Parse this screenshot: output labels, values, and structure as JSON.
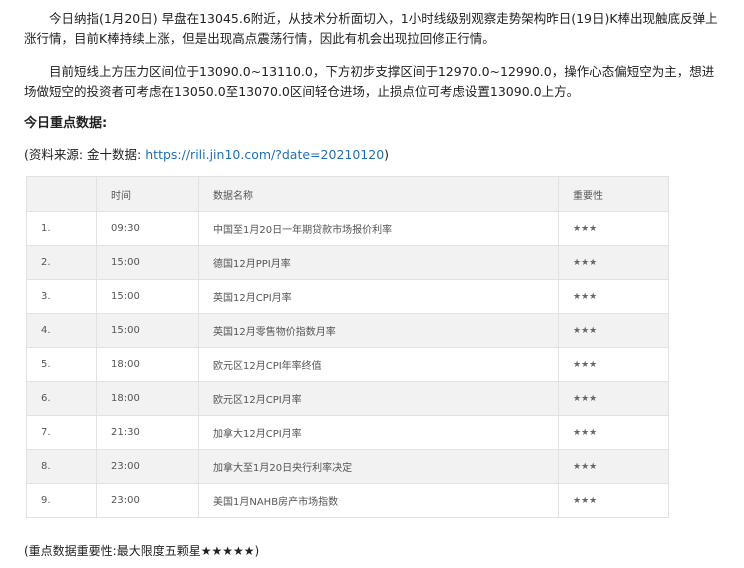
{
  "paragraphs": [
    "今日纳指(1月20日) 早盘在13045.6附近，从技术分析面切入，1小时线级别观察走势架构昨日(19日)K棒出现触底反弹上涨行情，目前K棒持续上涨，但是出现高点震荡行情，因此有机会出现拉回修正行情。",
    "目前短线上方压力区间位于13090.0~13110.0，下方初步支撑区间于12970.0~12990.0，操作心态偏短空为主，想进场做短空的投资者可考虑在13050.0至13070.0区间轻仓进场，止损点位可考虑设置13090.0上方。"
  ],
  "heading": "今日重点数据:",
  "source": {
    "prefix": "(资料来源: 金十数据: ",
    "url": "https://rili.jin10.com/?date=20210120",
    "suffix": ")"
  },
  "table": {
    "headers": [
      "",
      "时间",
      "数据名称",
      "重要性"
    ],
    "rows": [
      {
        "idx": "1.",
        "time": "09:30",
        "name": "中国至1月20日一年期贷款市场报价利率",
        "importance": "★★★"
      },
      {
        "idx": "2.",
        "time": "15:00",
        "name": "德国12月PPI月率",
        "importance": "★★★"
      },
      {
        "idx": "3.",
        "time": "15:00",
        "name": "英国12月CPI月率",
        "importance": "★★★"
      },
      {
        "idx": "4.",
        "time": "15:00",
        "name": "英国12月零售物价指数月率",
        "importance": "★★★"
      },
      {
        "idx": "5.",
        "time": "18:00",
        "name": "欧元区12月CPI年率终值",
        "importance": "★★★"
      },
      {
        "idx": "6.",
        "time": "18:00",
        "name": "欧元区12月CPI月率",
        "importance": "★★★"
      },
      {
        "idx": "7.",
        "time": "21:30",
        "name": "加拿大12月CPI月率",
        "importance": "★★★"
      },
      {
        "idx": "8.",
        "time": "23:00",
        "name": "加拿大至1月20日央行利率决定",
        "importance": "★★★"
      },
      {
        "idx": "9.",
        "time": "23:00",
        "name": "美国1月NAHB房产市场指数",
        "importance": "★★★"
      }
    ]
  },
  "note": "(重点数据重要性:最大限度五颗星★★★★★)",
  "colors": {
    "link": "#1f6fb5",
    "row_alt": "#f2f2f2",
    "border": "#e2e2e2"
  }
}
